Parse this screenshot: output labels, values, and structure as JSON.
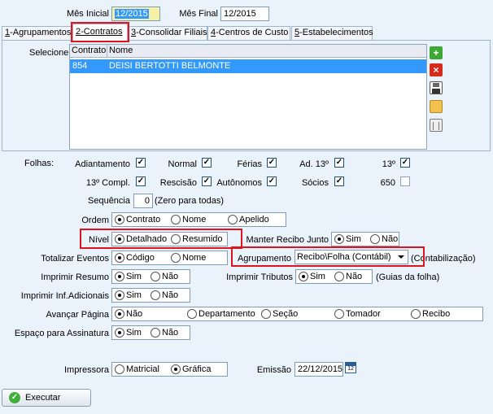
{
  "header": {
    "mes_inicial_label": "Mês Inicial",
    "mes_inicial_value": "12/2015",
    "mes_final_label": "Mês Final",
    "mes_final_value": "12/2015"
  },
  "tabs": [
    {
      "key": "1",
      "label": "-Agrupamentos"
    },
    {
      "key": "2",
      "label": "-Contratos"
    },
    {
      "key": "3",
      "label": "-Consolidar Filiais"
    },
    {
      "key": "4",
      "label": "-Centros de Custo"
    },
    {
      "key": "5",
      "label": "-Estabelecimentos"
    }
  ],
  "contratos": {
    "selecione_label": "Selecione",
    "col_contrato": "Contrato",
    "col_nome": "Nome",
    "rows": [
      {
        "contrato": "854",
        "nome": "DEISI BERTOTTI BELMONTE"
      }
    ]
  },
  "folhas": {
    "label": "Folhas:",
    "items": [
      {
        "label": "Adiantamento",
        "checked": true
      },
      {
        "label": "Normal",
        "checked": true
      },
      {
        "label": "Férias",
        "checked": true
      },
      {
        "label": "Ad. 13º",
        "checked": true
      },
      {
        "label": "13º",
        "checked": true
      },
      {
        "label": "13º Compl.",
        "checked": true
      },
      {
        "label": "Rescisão",
        "checked": true
      },
      {
        "label": "Autônomos",
        "checked": true
      },
      {
        "label": "Sócios",
        "checked": true
      },
      {
        "label": "650",
        "checked": false
      }
    ]
  },
  "sequencia": {
    "label": "Sequência",
    "value": "0",
    "hint": "(Zero para todas)"
  },
  "ordem": {
    "label": "Ordem",
    "options": [
      "Contrato",
      "Nome",
      "Apelido"
    ],
    "selected": "Contrato"
  },
  "nivel": {
    "label": "Nível",
    "options": [
      "Detalhado",
      "Resumido"
    ],
    "selected": "Detalhado"
  },
  "manter_recibo": {
    "label": "Manter Recibo Junto",
    "options": [
      "Sim",
      "Não"
    ],
    "selected": "Sim"
  },
  "totalizar": {
    "label": "Totalizar Eventos",
    "options": [
      "Código",
      "Nome"
    ],
    "selected": "Código"
  },
  "agrupamento": {
    "label": "Agrupamento",
    "value": "Recibo\\Folha (Contábil)",
    "suffix": "(Contabilização)"
  },
  "imprimir_resumo": {
    "label": "Imprimir Resumo",
    "options": [
      "Sim",
      "Não"
    ],
    "selected": "Sim"
  },
  "imprimir_tributos": {
    "label": "Imprimir Tributos",
    "options": [
      "Sim",
      "Não"
    ],
    "selected": "Sim",
    "suffix": "(Guias da folha)"
  },
  "imprimir_inf": {
    "label": "Imprimir Inf.Adicionais",
    "options": [
      "Sim",
      "Não"
    ],
    "selected": "Sim"
  },
  "avancar": {
    "label": "Avançar Página",
    "options": [
      "Não",
      "Departamento",
      "Seção",
      "Tomador",
      "Recibo"
    ],
    "selected": "Não"
  },
  "espaco": {
    "label": "Espaço para Assinatura",
    "options": [
      "Sim",
      "Não"
    ],
    "selected": "Sim"
  },
  "impressora": {
    "label": "Impressora",
    "options": [
      "Matricial",
      "Gráfica"
    ],
    "selected": "Gráfica"
  },
  "emissao": {
    "label": "Emissão",
    "value": "22/12/2015",
    "cal_text": "12"
  },
  "executar_label": "Executar",
  "colors": {
    "accent": "#3399ff",
    "highlight_box": "#e0141e",
    "background": "#eaf2fb"
  }
}
